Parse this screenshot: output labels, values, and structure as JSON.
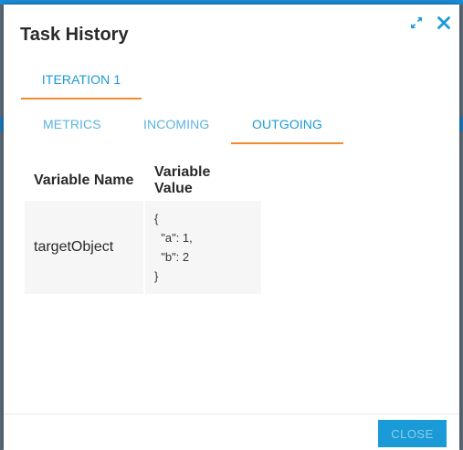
{
  "dialog": {
    "title": "Task History"
  },
  "iteration_tabs": [
    {
      "label": "ITERATION 1",
      "active": true
    }
  ],
  "section_tabs": [
    {
      "label": "METRICS",
      "active": false
    },
    {
      "label": "INCOMING",
      "active": false
    },
    {
      "label": "OUTGOING",
      "active": true
    }
  ],
  "table": {
    "headers": [
      "Variable Name",
      "Variable Value"
    ],
    "rows": [
      {
        "name": "targetObject",
        "value": "{\n  \"a\": 1,\n  \"b\": 2\n}"
      }
    ]
  },
  "footer": {
    "close_label": "CLOSE"
  },
  "icons": {
    "expand": "expand-icon",
    "close": "close-icon"
  },
  "colors": {
    "accent": "#1a9ad6",
    "tab_underline": "#f08a2c",
    "title_text": "#2a2a2a"
  }
}
